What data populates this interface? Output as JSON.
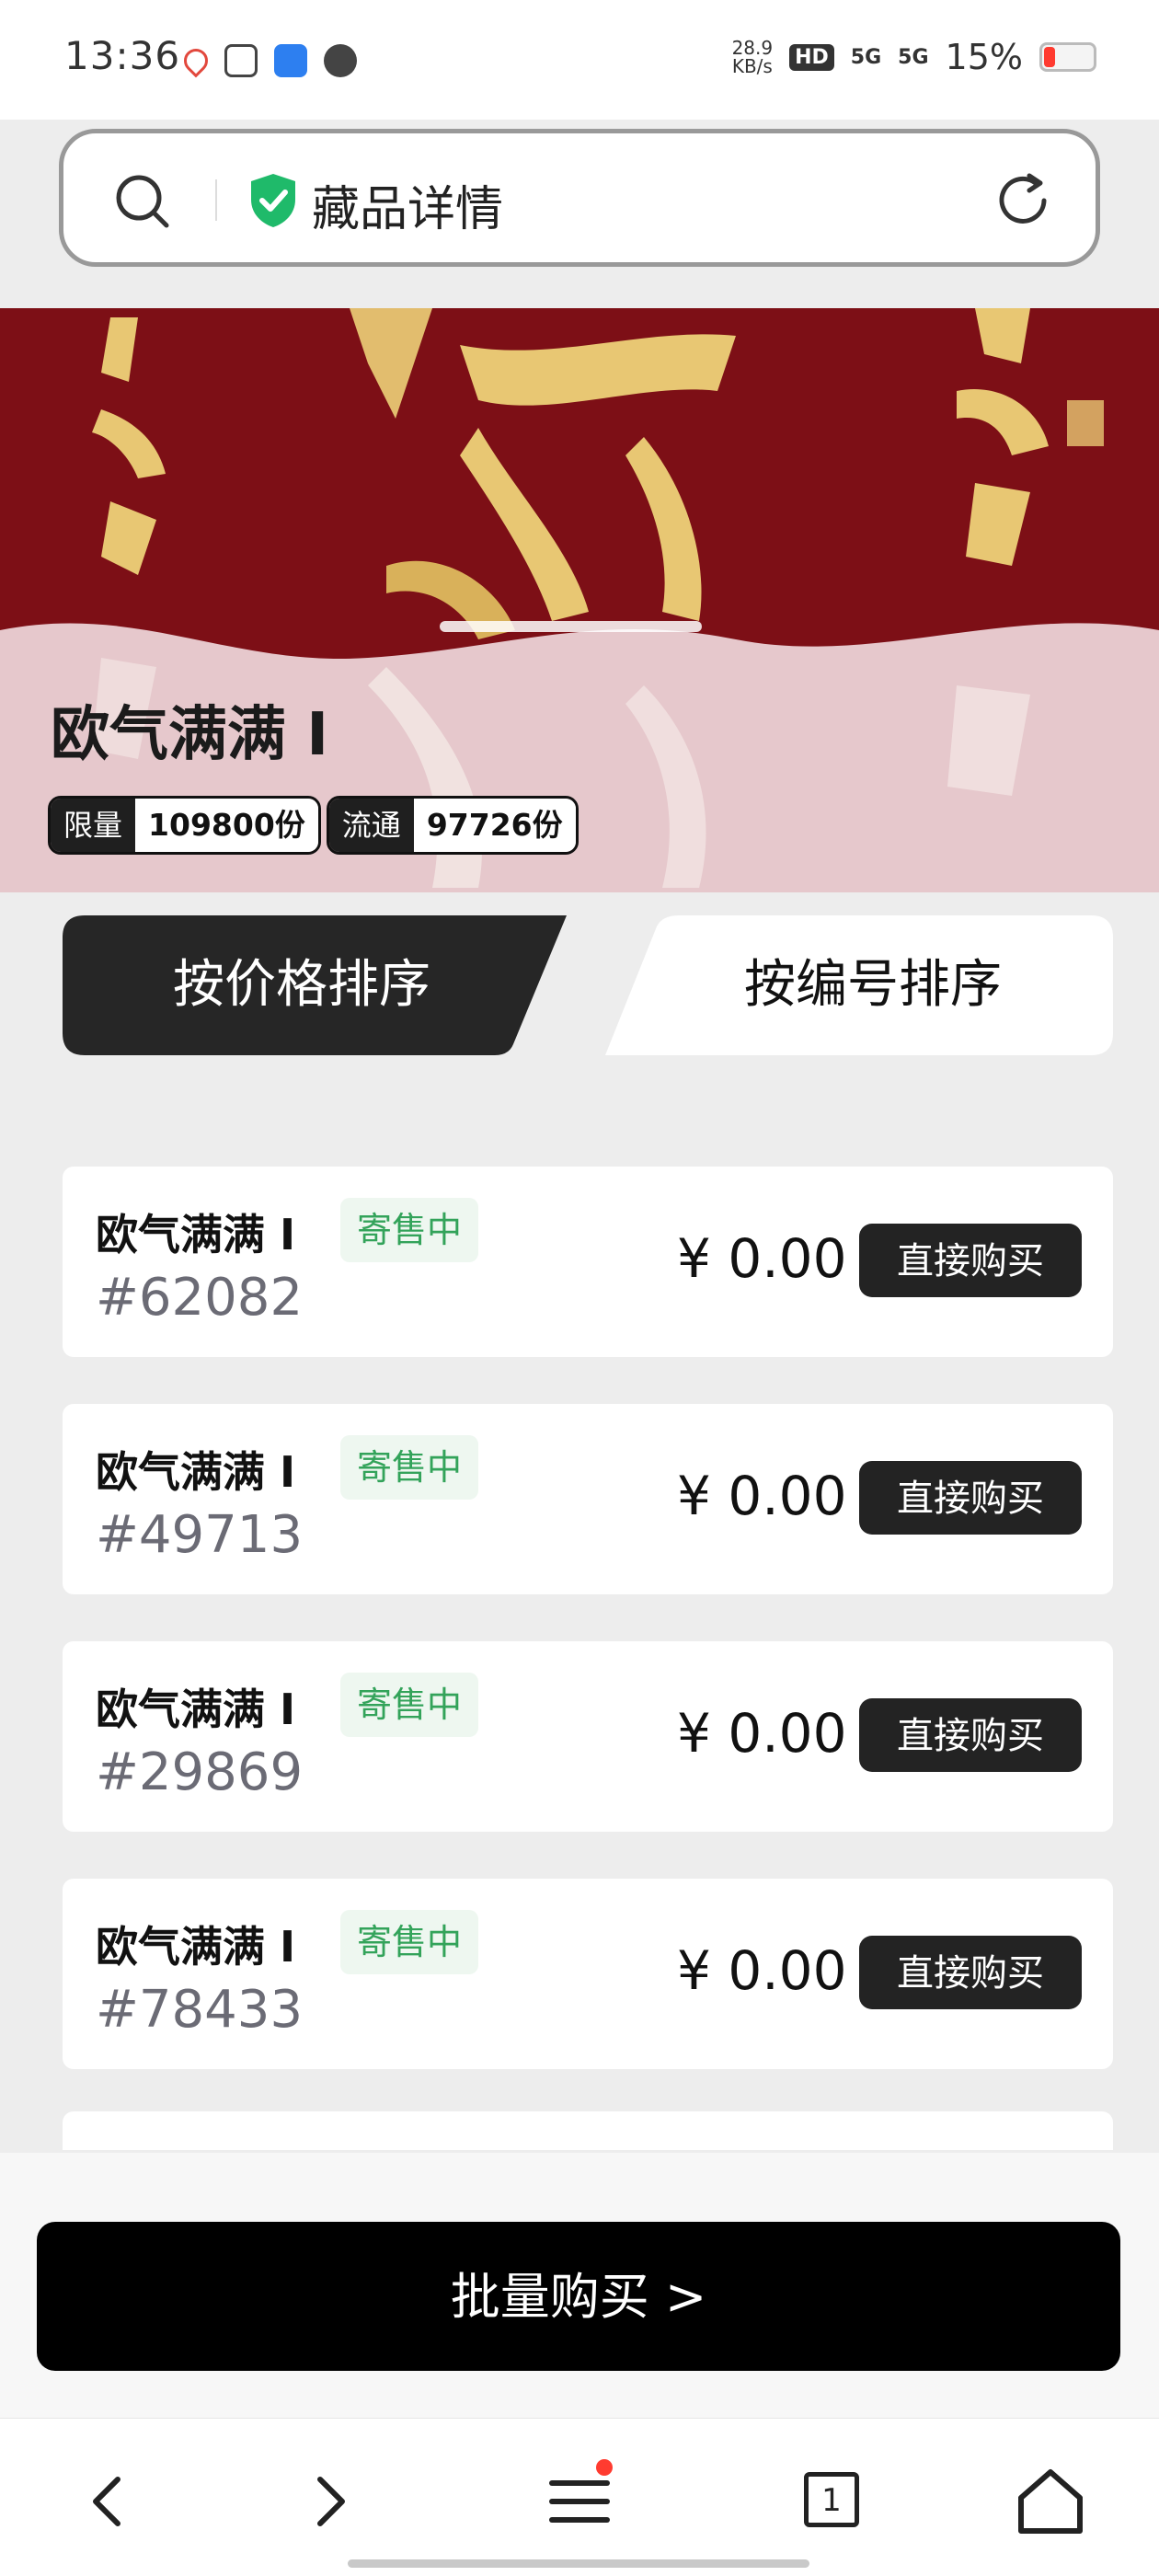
{
  "status_bar": {
    "time": "13:36",
    "net_speed_value": "28.9",
    "net_speed_unit": "KB/s",
    "hd_badge": "HD",
    "signal_1": "5G",
    "signal_2": "5G",
    "battery": "15%"
  },
  "address_bar": {
    "title": "藏品详情"
  },
  "hero": {
    "title": "欧气满满 I",
    "tags": [
      {
        "label": "限量",
        "value": "109800份"
      },
      {
        "label": "流通",
        "value": "97726份"
      }
    ]
  },
  "sort_tabs": {
    "by_price": "按价格排序",
    "by_number": "按编号排序"
  },
  "listings": [
    {
      "name": "欧气满满 I",
      "status": "寄售中",
      "serial": "#62082",
      "price": "¥ 0.00",
      "buy_label": "直接购买"
    },
    {
      "name": "欧气满满 I",
      "status": "寄售中",
      "serial": "#49713",
      "price": "¥ 0.00",
      "buy_label": "直接购买"
    },
    {
      "name": "欧气满满 I",
      "status": "寄售中",
      "serial": "#29869",
      "price": "¥ 0.00",
      "buy_label": "直接购买"
    },
    {
      "name": "欧气满满 I",
      "status": "寄售中",
      "serial": "#78433",
      "price": "¥ 0.00",
      "buy_label": "直接购买"
    }
  ],
  "batch_buy": {
    "label": "批量购买 >"
  },
  "nav": {
    "tab_count": "1"
  },
  "colors": {
    "hero_red": "#7d0f16",
    "hero_gold": "#e8c773",
    "status_green": "#33a35a",
    "shield_green": "#1fba6a"
  }
}
